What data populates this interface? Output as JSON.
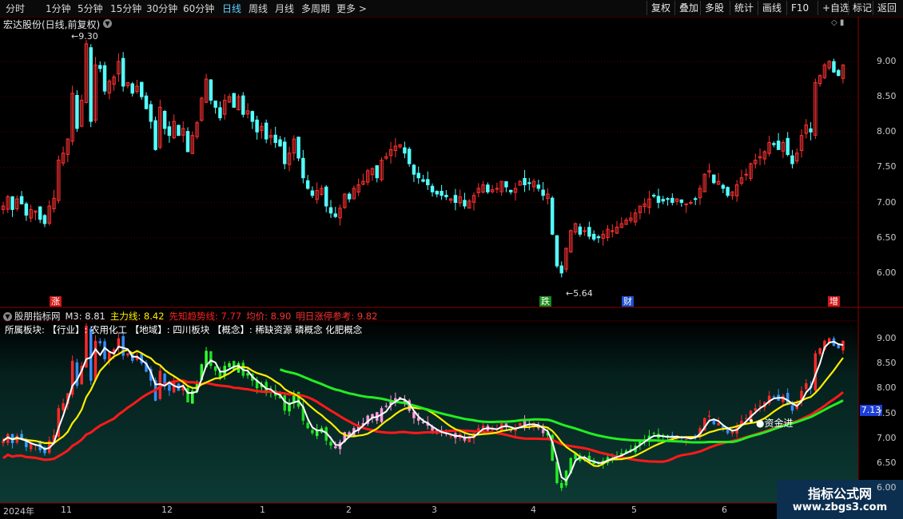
{
  "toolbar": {
    "periods": [
      {
        "label": "分时",
        "active": false
      },
      {
        "label": "1分钟",
        "active": false
      },
      {
        "label": "5分钟",
        "active": false
      },
      {
        "label": "15分钟",
        "active": false
      },
      {
        "label": "30分钟",
        "active": false
      },
      {
        "label": "60分钟",
        "active": false
      },
      {
        "label": "日线",
        "active": true
      },
      {
        "label": "周线",
        "active": false
      },
      {
        "label": "月线",
        "active": false
      },
      {
        "label": "多周期",
        "active": false
      },
      {
        "label": "更多 >",
        "active": false
      }
    ],
    "buttons": [
      "复权",
      "叠加",
      "多股",
      "统计",
      "画线",
      "F10",
      "+自选",
      "标记",
      "返回"
    ]
  },
  "main_chart": {
    "title": "宏达股份(日线,前复权)",
    "high_label": "9.30",
    "low_label": "5.64",
    "y_ticks": [
      "9.00",
      "8.50",
      "8.00",
      "7.50",
      "7.00",
      "6.50",
      "6.00"
    ],
    "event_tags": [
      {
        "label": "涨",
        "color": "#d01818"
      },
      {
        "label": "跌",
        "color": "#1a8a1a"
      },
      {
        "label": "财",
        "color": "#1a4fd0"
      },
      {
        "label": "增",
        "color": "#d01818"
      }
    ]
  },
  "indicator": {
    "name": "股朋指标网",
    "values": [
      {
        "text": "M3: 8.81",
        "color": "#e6e6e6"
      },
      {
        "text": "主力线: 8.42",
        "color": "#ffee00"
      },
      {
        "text": "先知趋势线: 7.77",
        "color": "#ff2020"
      },
      {
        "text": "均价: 8.90",
        "color": "#ff3030"
      },
      {
        "text": "明日涨停参考: 9.82",
        "color": "#ff3030"
      }
    ],
    "sector_line": "所属板块: 【行业】: 农用化工 【地域】: 四川板块 【概念】: 稀缺资源 磷概念 化肥概念",
    "y_ticks": [
      "9.00",
      "8.50",
      "8.00",
      "7.50",
      "7.00",
      "6.50",
      "6.00"
    ],
    "current_price": "7.13",
    "signal_label": "●资金进"
  },
  "x_axis": [
    "2024年",
    "11",
    "12",
    "1",
    "2",
    "3",
    "4",
    "5",
    "6"
  ],
  "watermark": {
    "line1": "指标公式网",
    "line2": "www.zbgs3.com"
  },
  "colors": {
    "up": "#ff3232",
    "down": "#54ffff",
    "ma_yellow": "#ffee00",
    "trend_red": "#ff1a1a",
    "ma_green": "#22ee22",
    "background": "#000000"
  },
  "chart_data": {
    "type": "candlestick",
    "title": "宏达股份(日线,前复权)",
    "ylim": [
      5.5,
      9.6
    ],
    "close": [
      6.95,
      7.08,
      6.9,
      7.05,
      6.98,
      6.82,
      6.9,
      6.88,
      6.76,
      6.7,
      6.95,
      7.06,
      7.6,
      7.7,
      7.9,
      8.55,
      8.05,
      8.45,
      9.25,
      8.15,
      8.95,
      8.9,
      8.58,
      8.72,
      8.78,
      9.0,
      8.65,
      8.7,
      8.55,
      8.65,
      8.5,
      8.33,
      8.15,
      7.75,
      8.35,
      8.05,
      7.95,
      8.15,
      7.95,
      8.05,
      7.72,
      7.95,
      8.13,
      8.48,
      8.75,
      8.45,
      8.35,
      8.2,
      8.45,
      8.5,
      8.35,
      8.5,
      8.25,
      8.3,
      8.15,
      8.0,
      8.08,
      7.9,
      7.95,
      7.85,
      7.8,
      7.55,
      7.7,
      7.9,
      7.63,
      7.35,
      7.2,
      7.1,
      7.17,
      7.2,
      6.95,
      6.85,
      6.8,
      6.92,
      7.12,
      7.05,
      7.2,
      7.25,
      7.3,
      7.45,
      7.48,
      7.35,
      7.6,
      7.65,
      7.75,
      7.8,
      7.82,
      7.7,
      7.55,
      7.4,
      7.35,
      7.3,
      7.25,
      7.15,
      7.12,
      7.1,
      7.08,
      7.05,
      7.0,
      7.08,
      6.95,
      7.02,
      7.1,
      7.2,
      7.25,
      7.15,
      7.18,
      7.2,
      7.3,
      7.22,
      7.15,
      7.2,
      7.3,
      7.25,
      7.28,
      7.3,
      7.2,
      7.1,
      7.12,
      6.55,
      6.1,
      6.0,
      6.35,
      6.6,
      6.7,
      6.55,
      6.6,
      6.52,
      6.48,
      6.5,
      6.55,
      6.62,
      6.6,
      6.65,
      6.7,
      6.75,
      6.78,
      6.85,
      6.95,
      6.98,
      7.05,
      7.1,
      7.0,
      7.02,
      7.05,
      7.0,
      7.05,
      7.0,
      6.98,
      7.0,
      7.05,
      7.2,
      7.4,
      7.45,
      7.28,
      7.3,
      7.2,
      7.1,
      7.15,
      7.25,
      7.35,
      7.4,
      7.55,
      7.6,
      7.65,
      7.72,
      7.85,
      7.82,
      7.75,
      7.85,
      7.68,
      7.55,
      7.7,
      7.95,
      8.1,
      8.0,
      8.7,
      8.8,
      8.95,
      9.0,
      8.85,
      8.8,
      8.95
    ]
  }
}
